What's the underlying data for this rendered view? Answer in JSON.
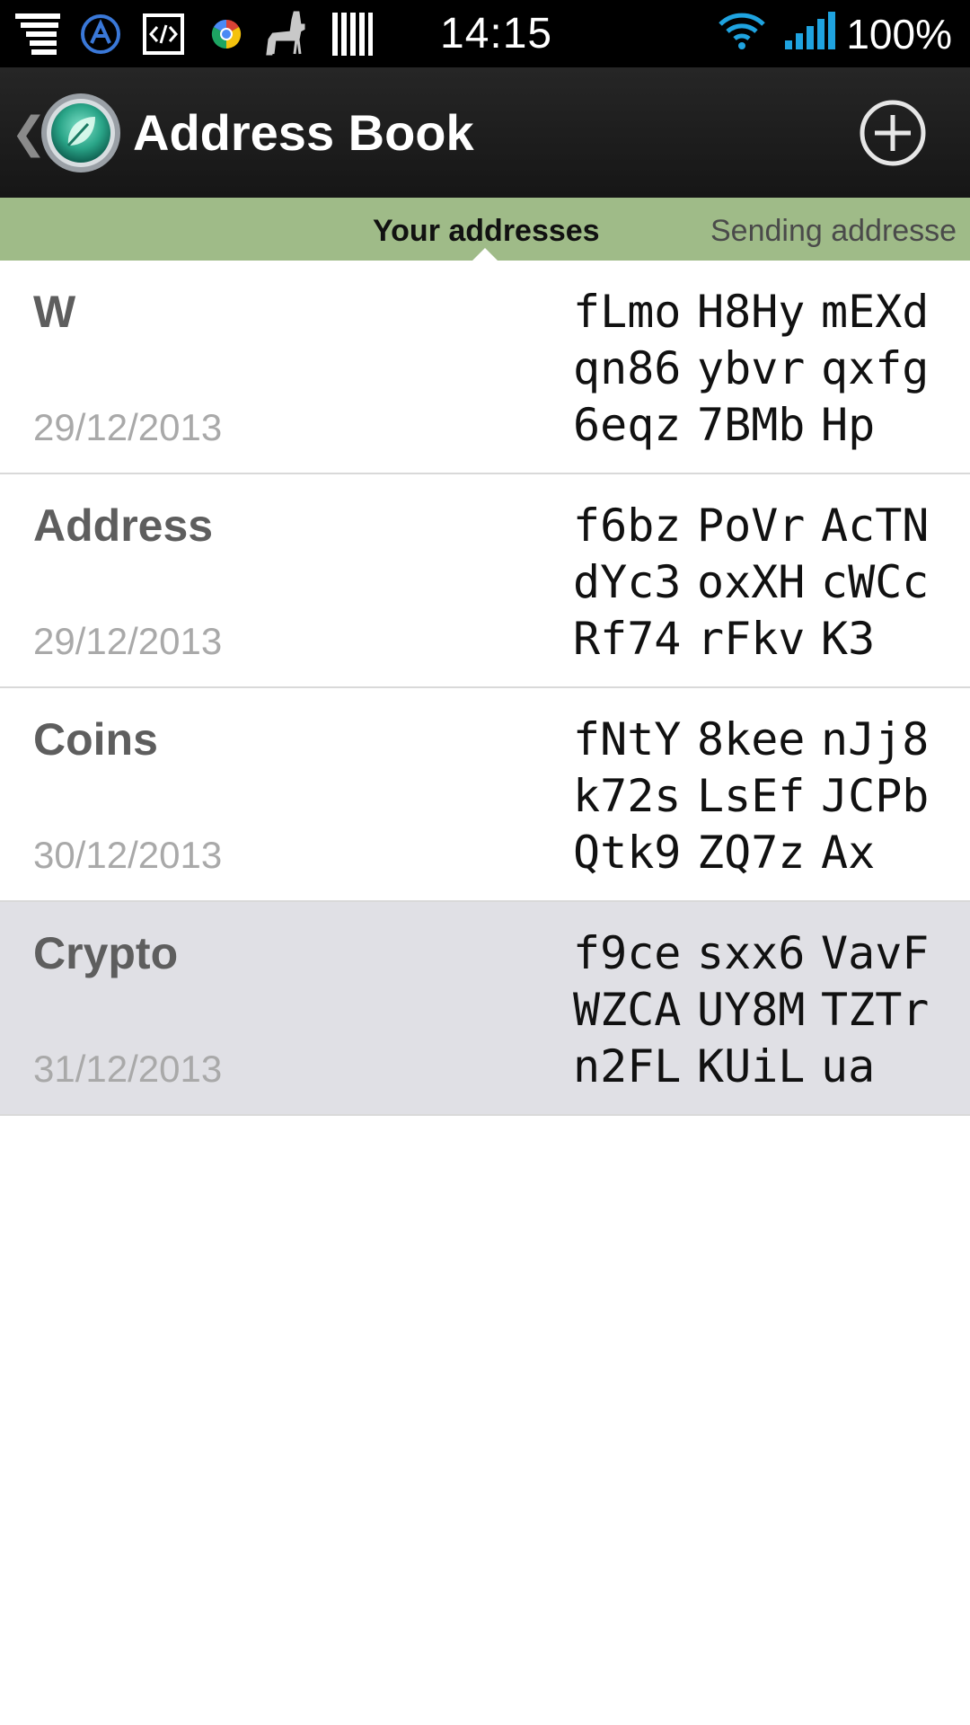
{
  "status_bar": {
    "time": "14:15",
    "battery": "100%",
    "left_icons": [
      "notification-stack-icon",
      "a-circle-icon",
      "code-icon",
      "chrome-icon",
      "llama-icon",
      "barcode-icon"
    ],
    "right_icons": [
      "wifi-icon",
      "signal-icon"
    ]
  },
  "action_bar": {
    "title": "Address Book",
    "up_icon": "chevron-left-icon",
    "logo_icon": "leaf-coin-icon",
    "action_icon": "add-circle-icon"
  },
  "tabs": [
    {
      "label": "Your addresses",
      "active": true
    },
    {
      "label": "Sending addresse",
      "active": false
    }
  ],
  "colors": {
    "tab_bar": "#9fbb88",
    "action_bar": "#1c1c1c",
    "selected_row": "#e0e0e5"
  },
  "addresses": [
    {
      "label": "W",
      "date": "29/12/2013",
      "lines": [
        [
          "fLmo",
          "H8Hy",
          "mEXd"
        ],
        [
          "qn86",
          "ybvr",
          "qxfg"
        ],
        [
          "6eqz",
          "7BMb",
          "Hp"
        ]
      ],
      "selected": false
    },
    {
      "label": "Address",
      "date": "29/12/2013",
      "lines": [
        [
          "f6bz",
          "PoVr",
          "AcTN"
        ],
        [
          "dYc3",
          "oxXH",
          "cWCc"
        ],
        [
          "Rf74",
          "rFkv",
          "K3"
        ]
      ],
      "selected": false
    },
    {
      "label": "Coins",
      "date": "30/12/2013",
      "lines": [
        [
          "fNtY",
          "8kee",
          "nJj8"
        ],
        [
          "k72s",
          "LsEf",
          "JCPb"
        ],
        [
          "Qtk9",
          "ZQ7z",
          "Ax"
        ]
      ],
      "selected": false
    },
    {
      "label": "Crypto",
      "date": "31/12/2013",
      "lines": [
        [
          "f9ce",
          "sxx6",
          "VavF"
        ],
        [
          "WZCA",
          "UY8M",
          "TZTr"
        ],
        [
          "n2FL",
          "KUiL",
          "ua"
        ]
      ],
      "selected": true
    }
  ]
}
